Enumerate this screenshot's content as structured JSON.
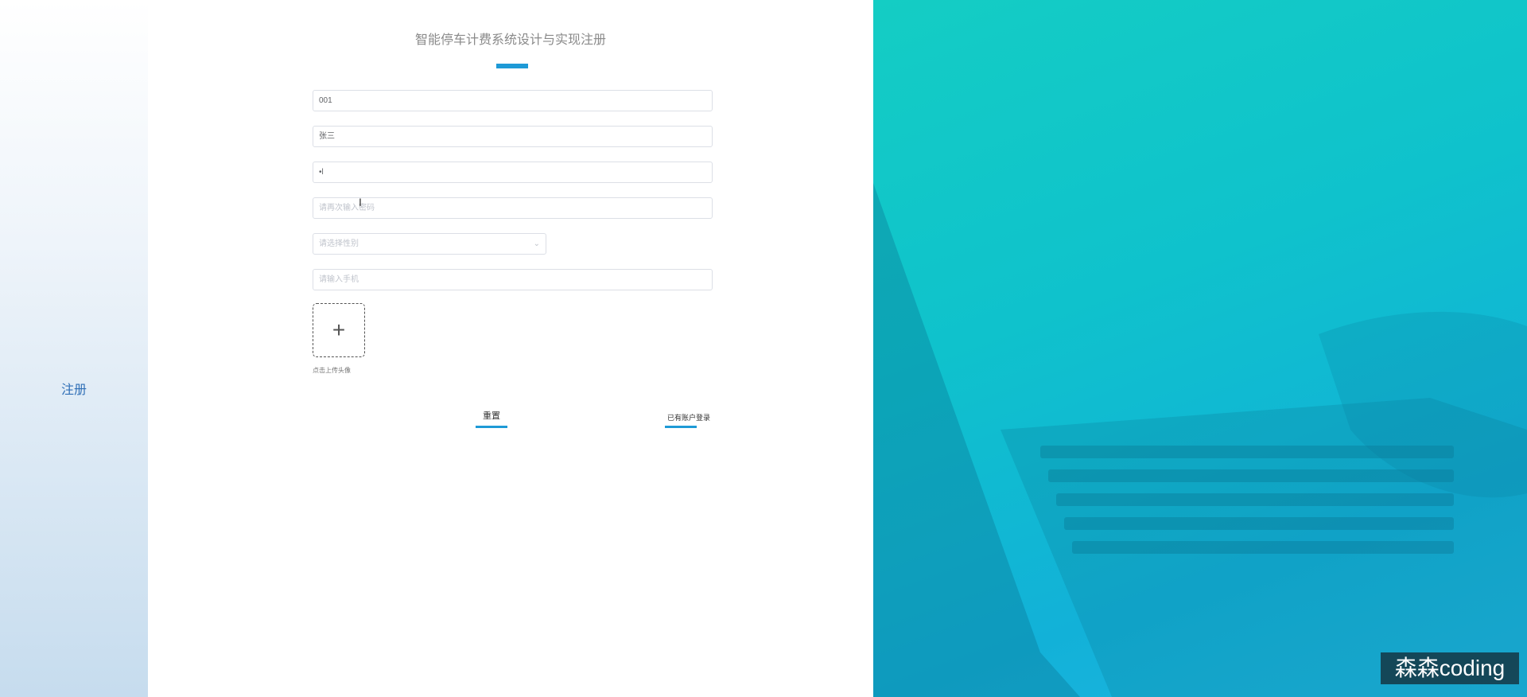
{
  "sidebar": {
    "register_label": "注册"
  },
  "form": {
    "title": "智能停车计费系统设计与实现注册",
    "fields": [
      {
        "value": "001",
        "placeholder": ""
      },
      {
        "value": "张三",
        "placeholder": ""
      },
      {
        "value": "•l",
        "placeholder": ""
      },
      {
        "value": "",
        "placeholder": "请再次输入密码"
      },
      {
        "value": "",
        "placeholder": "请选择性别"
      },
      {
        "value": "",
        "placeholder": "请输入手机"
      }
    ],
    "upload_hint": "点击上传头像",
    "reset_label": "重置",
    "login_link": "已有账户登录"
  },
  "watermark": "森森coding",
  "colors": {
    "accent": "#1e9ad6",
    "panel_start": "#14cdc4",
    "panel_end": "#20b6e2"
  }
}
